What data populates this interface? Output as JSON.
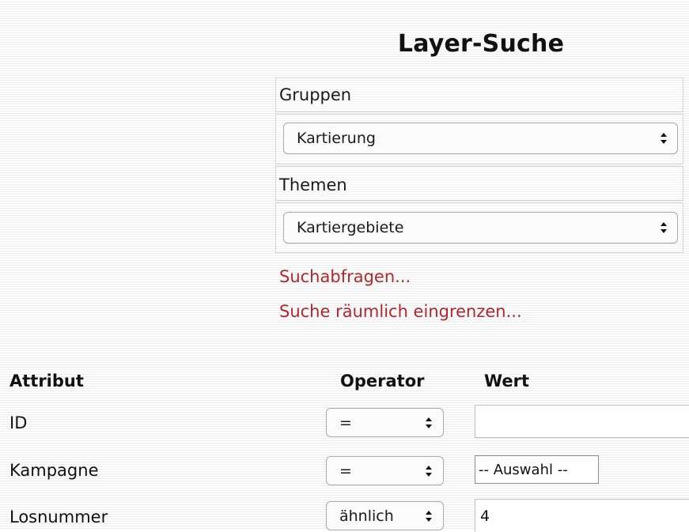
{
  "header": {
    "title": "Layer-Suche"
  },
  "groups": {
    "label": "Gruppen",
    "selected": "Kartierung"
  },
  "themes": {
    "label": "Themen",
    "selected": "Kartiergebiete"
  },
  "links": {
    "queries": "Suchabfragen...",
    "spatial": "Suche räumlich eingrenzen..."
  },
  "table": {
    "headers": {
      "attribute": "Attribut",
      "operator": "Operator",
      "value": "Wert"
    },
    "rows": [
      {
        "attribute": "ID",
        "operator": "=",
        "value": ""
      },
      {
        "attribute": "Kampagne",
        "operator": "=",
        "value": "-- Auswahl --"
      },
      {
        "attribute": "Losnummer",
        "operator": "ähnlich",
        "value": "4"
      }
    ]
  },
  "colors": {
    "link": "#b0272c",
    "stripe": "#ececec",
    "border": "#a9a9a9"
  },
  "icons": {
    "select_arrows": "up-down-chevron-icon"
  }
}
